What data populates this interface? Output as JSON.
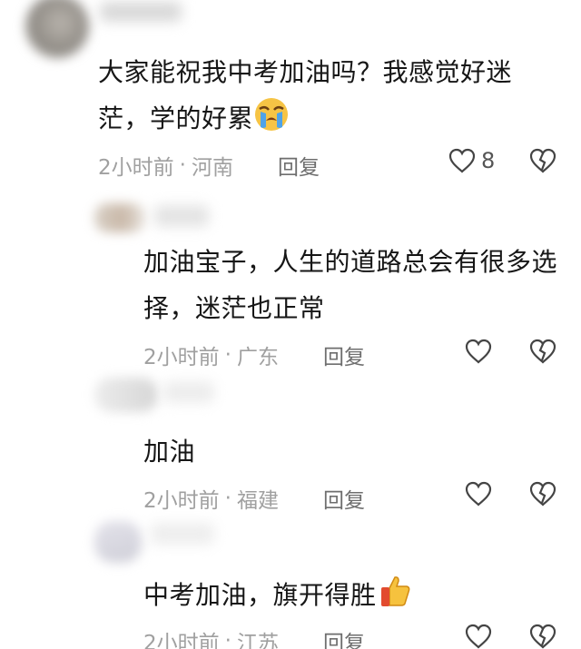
{
  "comments": [
    {
      "text": "大家能祝我中考加油吗？我感觉好迷茫，学的好累",
      "emoji": "crying-face",
      "time": "2小时前",
      "location": "河南",
      "reply_label": "回复",
      "likes": "8"
    }
  ],
  "replies": [
    {
      "text": "加油宝子，人生的道路总会有很多选择，迷茫也正常",
      "time": "2小时前",
      "location": "广东",
      "reply_label": "回复"
    },
    {
      "text": "加油",
      "time": "2小时前",
      "location": "福建",
      "reply_label": "回复"
    },
    {
      "text": "中考加油，旗开得胜",
      "emoji": "thumbs-up",
      "time": "2小时前",
      "location": "江苏",
      "reply_label": "回复"
    }
  ],
  "icons": {
    "like": "heart-outline-icon",
    "dislike": "broken-heart-icon"
  }
}
